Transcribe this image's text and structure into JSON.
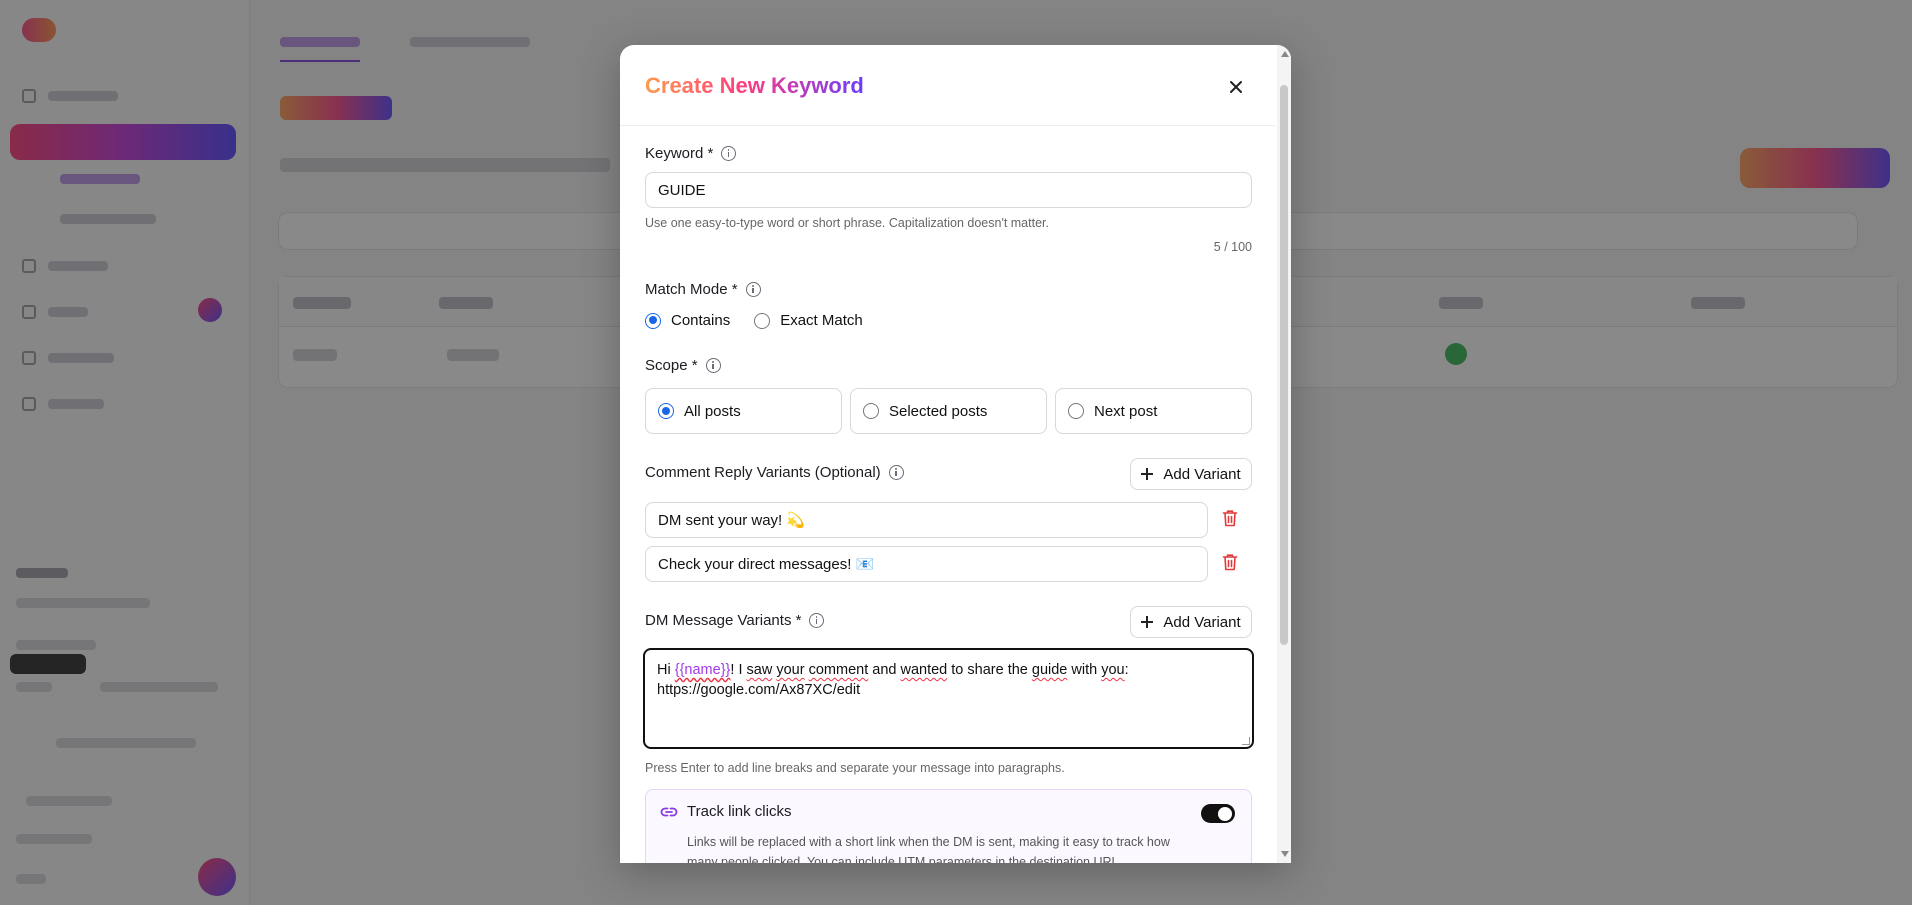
{
  "modal": {
    "title_part1": "Create",
    "title_part2": "New Keyword",
    "keyword": {
      "label": "Keyword *",
      "value": "GUIDE",
      "hint": "Use one easy-to-type word or short phrase. Capitalization doesn't matter.",
      "counter": "5 / 100"
    },
    "match_mode": {
      "label": "Match Mode *",
      "options": [
        "Contains",
        "Exact Match"
      ],
      "selected": "Contains"
    },
    "scope": {
      "label": "Scope *",
      "options": [
        "All posts",
        "Selected posts",
        "Next post"
      ],
      "selected": "All posts"
    },
    "comment_replies": {
      "label": "Comment Reply Variants (Optional)",
      "add_label": "Add Variant",
      "variants": [
        "DM sent your way! 💫",
        "Check your direct messages! 📧"
      ]
    },
    "dm_messages": {
      "label": "DM Message Variants *",
      "add_label": "Add Variant",
      "text_hi": "Hi ",
      "text_var": "{{name}}",
      "text_rest_1": "! I ",
      "text_w1": "saw",
      "text_sp2": " ",
      "text_w2": "your",
      "text_sp3": " ",
      "text_w3": "comment",
      "text_sp4": " and ",
      "text_w4": "wanted",
      "text_sp5": " to share the ",
      "text_w5": "guide",
      "text_sp6": " with ",
      "text_w6": "you",
      "text_tail": ":",
      "text_line2": "https://google.com/Ax87XC/edit",
      "hint": "Press Enter to add line breaks and separate your message into paragraphs."
    },
    "track_links": {
      "title": "Track link clicks",
      "enabled": true,
      "description": "Links will be replaced with a short link when the DM is sent, making it easy to track how many people clicked. You can include UTM parameters in the destination URL."
    }
  },
  "colors": {
    "accent_blue": "#1a66e8",
    "danger": "#e03a3a",
    "link_purple": "#a23be8"
  }
}
